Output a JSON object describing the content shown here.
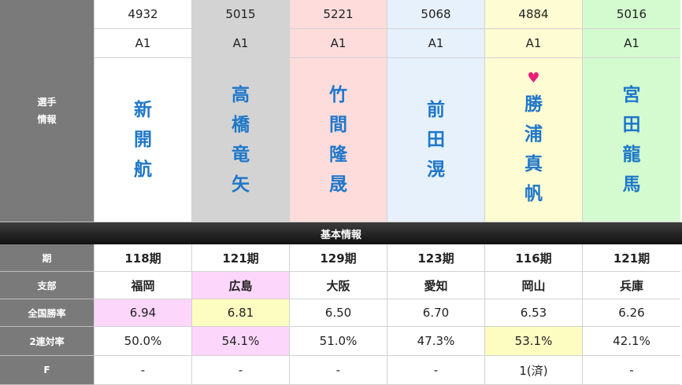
{
  "labels": {
    "player_info_line1": "選手",
    "player_info_line2": "情報",
    "section_title": "基本情報",
    "term": "期",
    "branch": "支部",
    "national_win_rate": "全国勝率",
    "two_place_rate": "2連対率",
    "flying": "F"
  },
  "racers": [
    {
      "id": "4932",
      "grade": "A1",
      "name_chars": [
        "新",
        "開",
        "航"
      ],
      "term": "118期",
      "branch": "福岡",
      "win_rate": "6.94",
      "two_rate": "50.0%",
      "f": "-"
    },
    {
      "id": "5015",
      "grade": "A1",
      "name_chars": [
        "高",
        "橋",
        "竜",
        "矢"
      ],
      "term": "121期",
      "branch": "広島",
      "win_rate": "6.81",
      "two_rate": "54.1%",
      "f": "-"
    },
    {
      "id": "5221",
      "grade": "A1",
      "name_chars": [
        "竹",
        "間",
        "隆",
        "晟"
      ],
      "term": "129期",
      "branch": "大阪",
      "win_rate": "6.50",
      "two_rate": "51.0%",
      "f": "-"
    },
    {
      "id": "5068",
      "grade": "A1",
      "name_chars": [
        "前",
        "田",
        "滉"
      ],
      "term": "123期",
      "branch": "愛知",
      "win_rate": "6.70",
      "two_rate": "47.3%",
      "f": "-"
    },
    {
      "id": "4884",
      "grade": "A1",
      "name_chars": [
        "勝",
        "浦",
        "真",
        "帆"
      ],
      "heart": "♥",
      "term": "116期",
      "branch": "岡山",
      "win_rate": "6.53",
      "two_rate": "53.1%",
      "f": "1(済)"
    },
    {
      "id": "5016",
      "grade": "A1",
      "name_chars": [
        "宮",
        "田",
        "龍",
        "馬"
      ],
      "term": "121期",
      "branch": "兵庫",
      "win_rate": "6.26",
      "two_rate": "42.1%",
      "f": "-"
    }
  ],
  "colors": {
    "lane_1": "#ffffff",
    "lane_2": "#d3d3d3",
    "lane_3": "#fedcdc",
    "lane_4": "#e6f1fc",
    "lane_5": "#fefcd2",
    "lane_6": "#d3fbcf",
    "highlight_pink": "#fdd6fb",
    "highlight_yellow": "#fdfcc1",
    "name_blue": "#1f77c9",
    "heart": "#e8207a"
  }
}
